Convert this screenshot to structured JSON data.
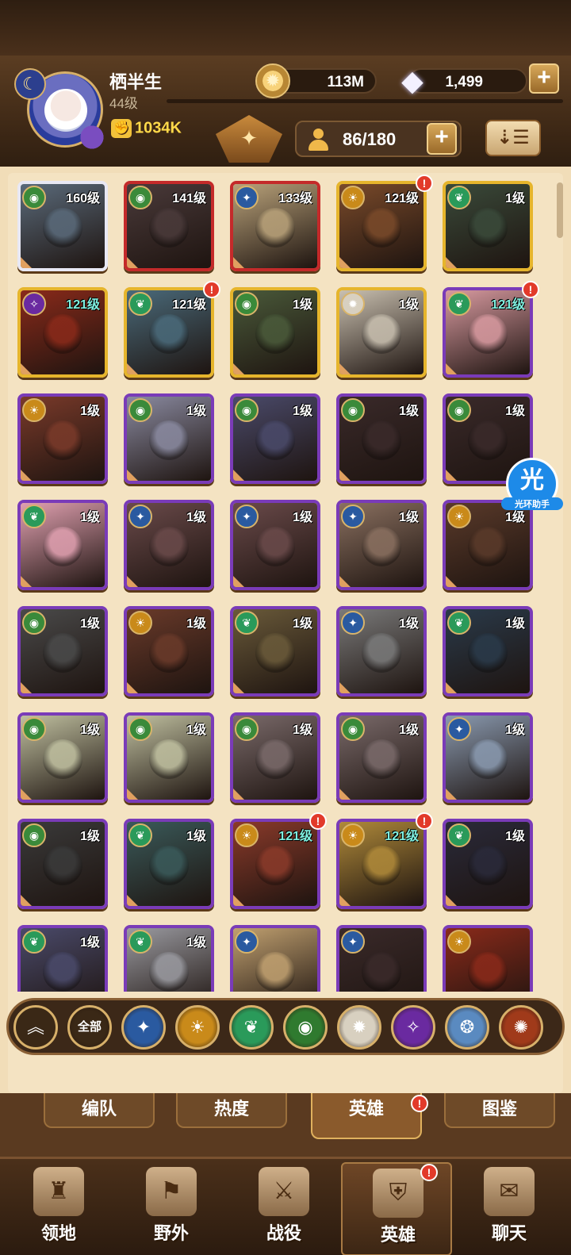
{
  "header": {
    "player_name": "栖半生",
    "player_level": "44级",
    "power": "1034K",
    "gold": "113M",
    "gems": "1,499",
    "capacity": "86/180"
  },
  "heroes": [
    {
      "level": "160级",
      "frame": "white",
      "faction_color": "#3a8a3a",
      "faction_icon": "eye-icon",
      "alert": false,
      "art": "#5a6a7a"
    },
    {
      "level": "141级",
      "frame": "red",
      "faction_color": "#3a8a3a",
      "faction_icon": "eye-icon",
      "alert": false,
      "art": "#4a3a3a"
    },
    {
      "level": "133级",
      "frame": "red",
      "faction_color": "#2a5aa0",
      "faction_icon": "star-icon",
      "alert": false,
      "art": "#b9a27a"
    },
    {
      "level": "121级",
      "frame": "gold",
      "faction_color": "#c98a1a",
      "faction_icon": "sun-icon",
      "alert": true,
      "art": "#7a4a2a"
    },
    {
      "level": "1级",
      "frame": "gold",
      "faction_color": "#2a9a5a",
      "faction_icon": "leaf-icon",
      "alert": false,
      "art": "#3a4a3a"
    },
    {
      "level": "121级",
      "frame": "gold",
      "faction_color": "#6a2aa0",
      "faction_icon": "skull-icon",
      "alert": false,
      "art": "#8a2a1a",
      "teal": true
    },
    {
      "level": "121级",
      "frame": "gold",
      "faction_color": "#2a9a5a",
      "faction_icon": "leaf-icon",
      "alert": true,
      "art": "#4a6a7a"
    },
    {
      "level": "1级",
      "frame": "gold",
      "faction_color": "#3a8a3a",
      "faction_icon": "eye-icon",
      "alert": false,
      "art": "#4a5a3a"
    },
    {
      "level": "1级",
      "frame": "gold",
      "faction_color": "#d8d0c0",
      "faction_icon": "light-icon",
      "alert": false,
      "art": "#c9c0b0"
    },
    {
      "level": "121级",
      "frame": "purple",
      "faction_color": "#2a9a5a",
      "faction_icon": "leaf-icon",
      "alert": true,
      "art": "#d89aa0",
      "teal": true
    },
    {
      "level": "1级",
      "frame": "purple",
      "faction_color": "#c98a1a",
      "faction_icon": "sun-icon",
      "alert": false,
      "art": "#7a3a2a"
    },
    {
      "level": "1级",
      "frame": "purple",
      "faction_color": "#3a8a3a",
      "faction_icon": "eye-icon",
      "alert": false,
      "art": "#8a8aa0"
    },
    {
      "level": "1级",
      "frame": "purple",
      "faction_color": "#3a8a3a",
      "faction_icon": "eye-icon",
      "alert": false,
      "art": "#4a4a6a"
    },
    {
      "level": "1级",
      "frame": "purple",
      "faction_color": "#3a8a3a",
      "faction_icon": "eye-icon",
      "alert": false,
      "art": "#3a2a2a"
    },
    {
      "level": "1级",
      "frame": "purple",
      "faction_color": "#3a8a3a",
      "faction_icon": "eye-icon",
      "alert": false,
      "art": "#3a2a2a"
    },
    {
      "level": "1级",
      "frame": "purple",
      "faction_color": "#2a9a5a",
      "faction_icon": "leaf-icon",
      "alert": false,
      "art": "#e0a0b0"
    },
    {
      "level": "1级",
      "frame": "purple",
      "faction_color": "#2a5aa0",
      "faction_icon": "star-icon",
      "alert": false,
      "art": "#6a4a4a"
    },
    {
      "level": "1级",
      "frame": "purple",
      "faction_color": "#2a5aa0",
      "faction_icon": "star-icon",
      "alert": false,
      "art": "#6a4a4a"
    },
    {
      "level": "1级",
      "frame": "purple",
      "faction_color": "#2a5aa0",
      "faction_icon": "star-icon",
      "alert": false,
      "art": "#8a7060"
    },
    {
      "level": "1级",
      "frame": "purple",
      "faction_color": "#c98a1a",
      "faction_icon": "sun-icon",
      "alert": false,
      "art": "#5a3a2a"
    },
    {
      "level": "1级",
      "frame": "purple",
      "faction_color": "#3a8a3a",
      "faction_icon": "eye-icon",
      "alert": false,
      "art": "#4a4a4a"
    },
    {
      "level": "1级",
      "frame": "purple",
      "faction_color": "#c98a1a",
      "faction_icon": "sun-icon",
      "alert": false,
      "art": "#6a3a2a"
    },
    {
      "level": "1级",
      "frame": "purple",
      "faction_color": "#2a9a5a",
      "faction_icon": "leaf-icon",
      "alert": false,
      "art": "#6a5a3a"
    },
    {
      "level": "1级",
      "frame": "purple",
      "faction_color": "#2a5aa0",
      "faction_icon": "star-icon",
      "alert": false,
      "art": "#7a7a7a"
    },
    {
      "level": "1级",
      "frame": "purple",
      "faction_color": "#2a9a5a",
      "faction_icon": "leaf-icon",
      "alert": false,
      "art": "#2a3a4a"
    },
    {
      "level": "1级",
      "frame": "purple",
      "faction_color": "#3a8a3a",
      "faction_icon": "eye-icon",
      "alert": false,
      "art": "#c0c0a0"
    },
    {
      "level": "1级",
      "frame": "purple",
      "faction_color": "#3a8a3a",
      "faction_icon": "eye-icon",
      "alert": false,
      "art": "#c0c0a0"
    },
    {
      "level": "1级",
      "frame": "purple",
      "faction_color": "#3a8a3a",
      "faction_icon": "eye-icon",
      "alert": false,
      "art": "#7a6a6a"
    },
    {
      "level": "1级",
      "frame": "purple",
      "faction_color": "#3a8a3a",
      "faction_icon": "eye-icon",
      "alert": false,
      "art": "#7a6a6a"
    },
    {
      "level": "1级",
      "frame": "purple",
      "faction_color": "#2a5aa0",
      "faction_icon": "star-icon",
      "alert": false,
      "art": "#8a9ab0"
    },
    {
      "level": "1级",
      "frame": "purple",
      "faction_color": "#3a8a3a",
      "faction_icon": "eye-icon",
      "alert": false,
      "art": "#3a3a3a"
    },
    {
      "level": "1级",
      "frame": "purple",
      "faction_color": "#2a9a5a",
      "faction_icon": "leaf-icon",
      "alert": false,
      "art": "#3a5a5a"
    },
    {
      "level": "121级",
      "frame": "purple",
      "faction_color": "#c98a1a",
      "faction_icon": "sun-icon",
      "alert": true,
      "art": "#8a3a2a",
      "teal": true
    },
    {
      "level": "121级",
      "frame": "purple",
      "faction_color": "#c98a1a",
      "faction_icon": "sun-icon",
      "alert": true,
      "art": "#b08a3a",
      "teal": true
    },
    {
      "level": "1级",
      "frame": "purple",
      "faction_color": "#2a9a5a",
      "faction_icon": "leaf-icon",
      "alert": false,
      "art": "#2a2a3a"
    },
    {
      "level": "1级",
      "frame": "purple",
      "faction_color": "#2a9a5a",
      "faction_icon": "leaf-icon",
      "alert": false,
      "art": "#4a4a6a"
    },
    {
      "level": "1级",
      "frame": "purple",
      "faction_color": "#2a9a5a",
      "faction_icon": "leaf-icon",
      "alert": false,
      "art": "#9a9aa0"
    },
    {
      "level": "",
      "frame": "purple",
      "faction_color": "#2a5aa0",
      "faction_icon": "star-icon",
      "alert": false,
      "art": "#c0a070"
    },
    {
      "level": "",
      "frame": "purple",
      "faction_color": "#2a5aa0",
      "faction_icon": "star-icon",
      "alert": false,
      "art": "#3a2a2a"
    },
    {
      "level": "",
      "frame": "purple",
      "faction_color": "#c98a1a",
      "faction_icon": "sun-icon",
      "alert": false,
      "art": "#8a2a1a"
    }
  ],
  "assist": {
    "glyph": "光",
    "label": "光环助手"
  },
  "filters": [
    {
      "name": "all-filter",
      "label": "全部",
      "color": "#3a2816"
    },
    {
      "name": "star-faction-filter",
      "label": "✦",
      "color": "#2a5aa0"
    },
    {
      "name": "sun-faction-filter",
      "label": "☀",
      "color": "#c98a1a"
    },
    {
      "name": "leaf-faction-filter",
      "label": "❦",
      "color": "#2a9a5a"
    },
    {
      "name": "eye-faction-filter",
      "label": "◉",
      "color": "#2f7a2f"
    },
    {
      "name": "light-faction-filter",
      "label": "✹",
      "color": "#d8d0c0"
    },
    {
      "name": "dark-faction-filter",
      "label": "✧",
      "color": "#6a2aa0"
    },
    {
      "name": "celestial-faction-filter",
      "label": "❂",
      "color": "#5a8ac0"
    },
    {
      "name": "hypogean-faction-filter",
      "label": "✺",
      "color": "#a03a1a"
    }
  ],
  "subtabs": [
    "编队",
    "热度",
    "英雄",
    "图鉴"
  ],
  "nav": [
    {
      "label": "领地",
      "icon": "♜"
    },
    {
      "label": "野外",
      "icon": "⚑"
    },
    {
      "label": "战役",
      "icon": "⚔"
    },
    {
      "label": "英雄",
      "icon": "⛨"
    },
    {
      "label": "聊天",
      "icon": "✉"
    }
  ]
}
